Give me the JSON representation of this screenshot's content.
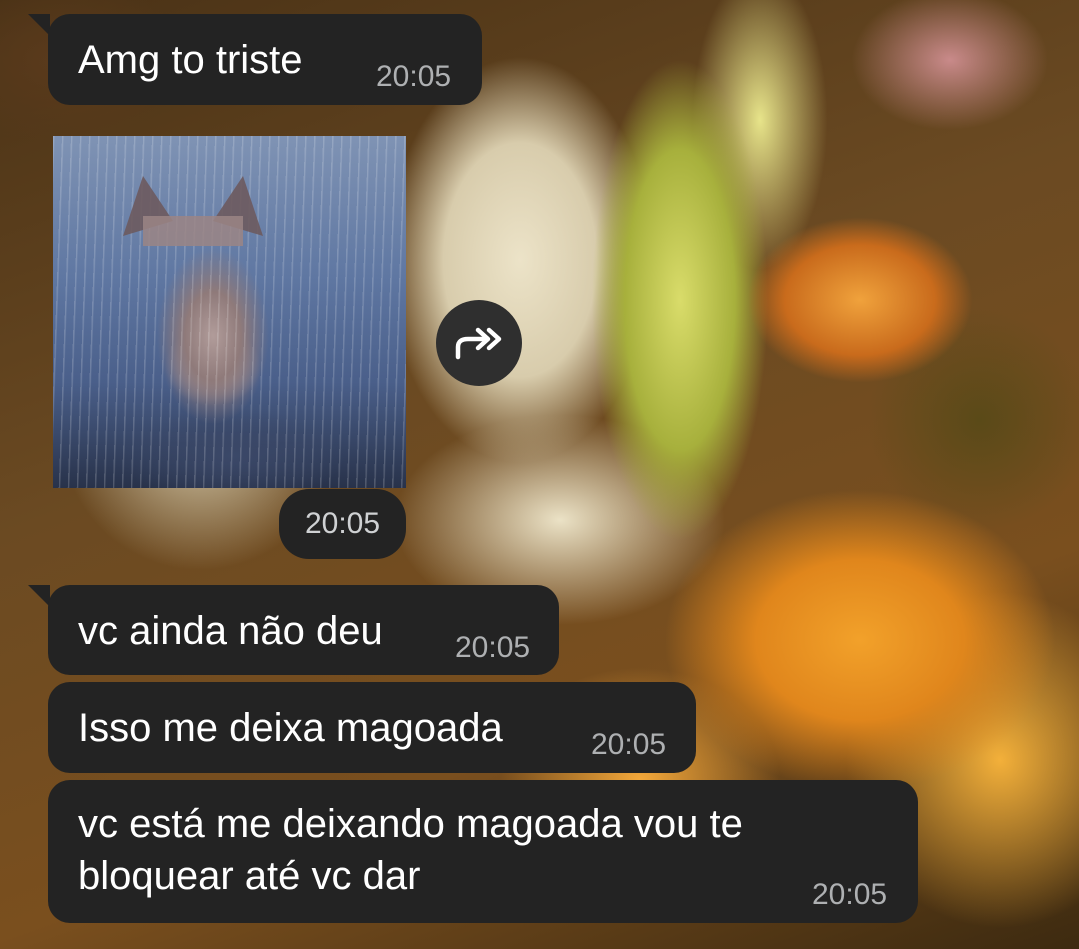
{
  "messages": [
    {
      "text": "Amg to triste",
      "time": "20:05"
    },
    {
      "type": "image",
      "image_description": "cat-in-rain-photo",
      "time": "20:05"
    },
    {
      "text": "vc ainda não deu",
      "time": "20:05"
    },
    {
      "text": "Isso me deixa magoada",
      "time": "20:05"
    },
    {
      "text_line1": "vc está me deixando magoada vou te",
      "text_line2": "bloquear até vc dar",
      "time": "20:05"
    }
  ],
  "icons": {
    "forward": "forward-arrows-icon"
  },
  "colors": {
    "bubble": "#232323",
    "time": "#aeb0b2",
    "text": "#ffffff"
  }
}
